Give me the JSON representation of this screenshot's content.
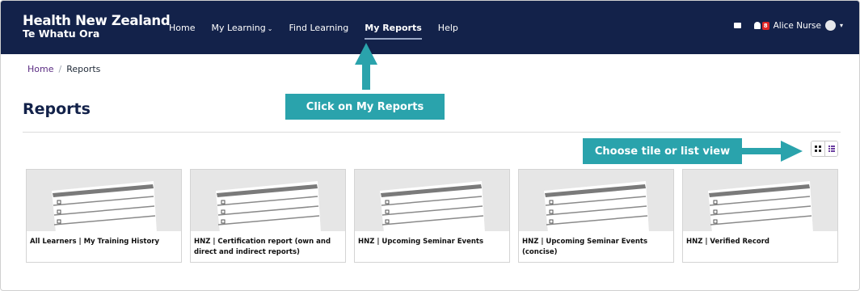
{
  "header": {
    "brand_line1": "Health New Zealand",
    "brand_line2": "Te Whatu Ora",
    "nav": [
      {
        "label": "Home"
      },
      {
        "label": "My Learning"
      },
      {
        "label": "Find Learning"
      },
      {
        "label": "My Reports"
      },
      {
        "label": "Help"
      }
    ],
    "notification_count": "8",
    "user_name": "Alice Nurse"
  },
  "breadcrumb": {
    "home": "Home",
    "separator": "/",
    "current": "Reports"
  },
  "page_title": "Reports",
  "callouts": {
    "reports": "Click on My Reports",
    "view": "Choose tile or list view"
  },
  "tiles": [
    {
      "label": "All Learners | My Training History"
    },
    {
      "label": "HNZ | Certification report (own and direct and indirect reports)"
    },
    {
      "label": "HNZ | Upcoming Seminar Events"
    },
    {
      "label": "HNZ | Upcoming Seminar Events (concise)"
    },
    {
      "label": "HNZ | Verified Record"
    }
  ],
  "colors": {
    "navbar": "#13224a",
    "callout": "#2aa3ac",
    "link": "#5b2c83",
    "badge": "#e02424"
  },
  "icons": {
    "mail": "mail-icon",
    "bell": "bell-icon",
    "tile_view": "grid-icon",
    "list_view": "list-icon"
  }
}
